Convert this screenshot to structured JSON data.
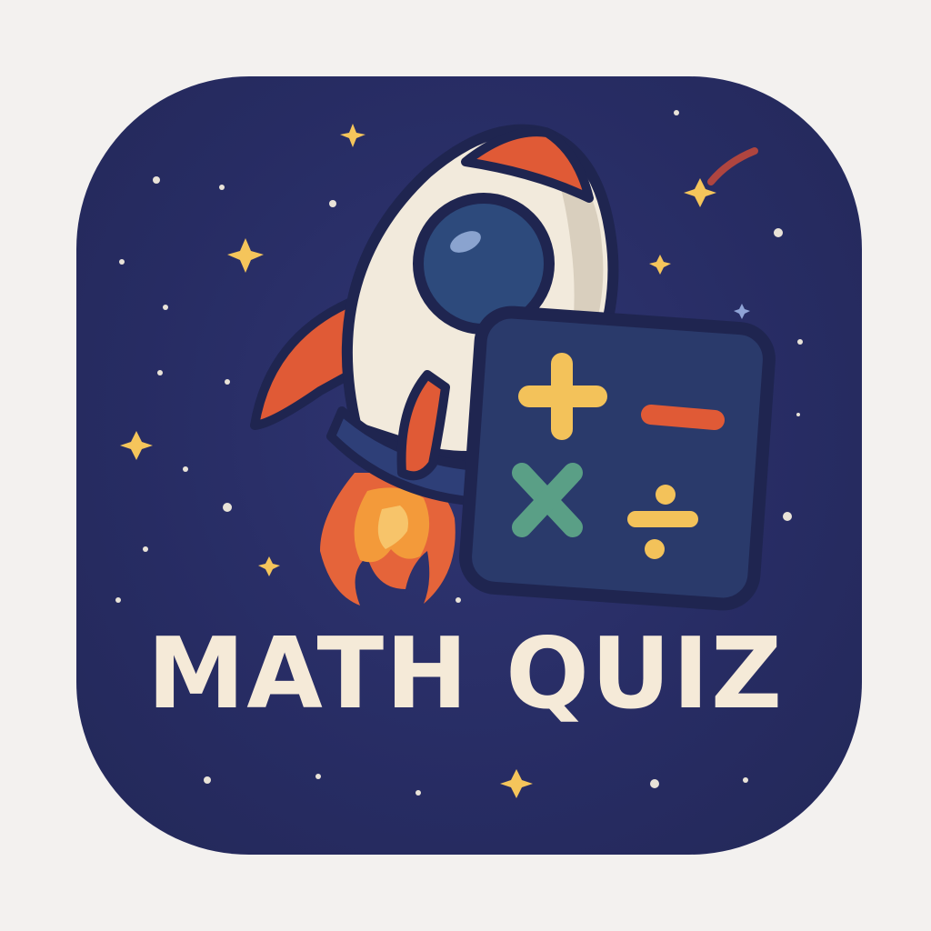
{
  "app_icon": {
    "title": "MATH QUIZ",
    "icon_name": "rocket-math-quiz-icon",
    "colors": {
      "background": "#272c63",
      "text": "#f5ead8",
      "rocket_body": "#f2eadc",
      "rocket_fins": "#e05a36",
      "window": "#2d4a7c",
      "card": "#2a3a6b",
      "plus": "#f3c25a",
      "minus": "#e05a36",
      "times": "#5a9f86",
      "divide": "#f3c25a",
      "flame": "#f08a3a",
      "star": "#f5c55b"
    },
    "symbols": [
      "plus",
      "minus",
      "times",
      "divide"
    ]
  }
}
